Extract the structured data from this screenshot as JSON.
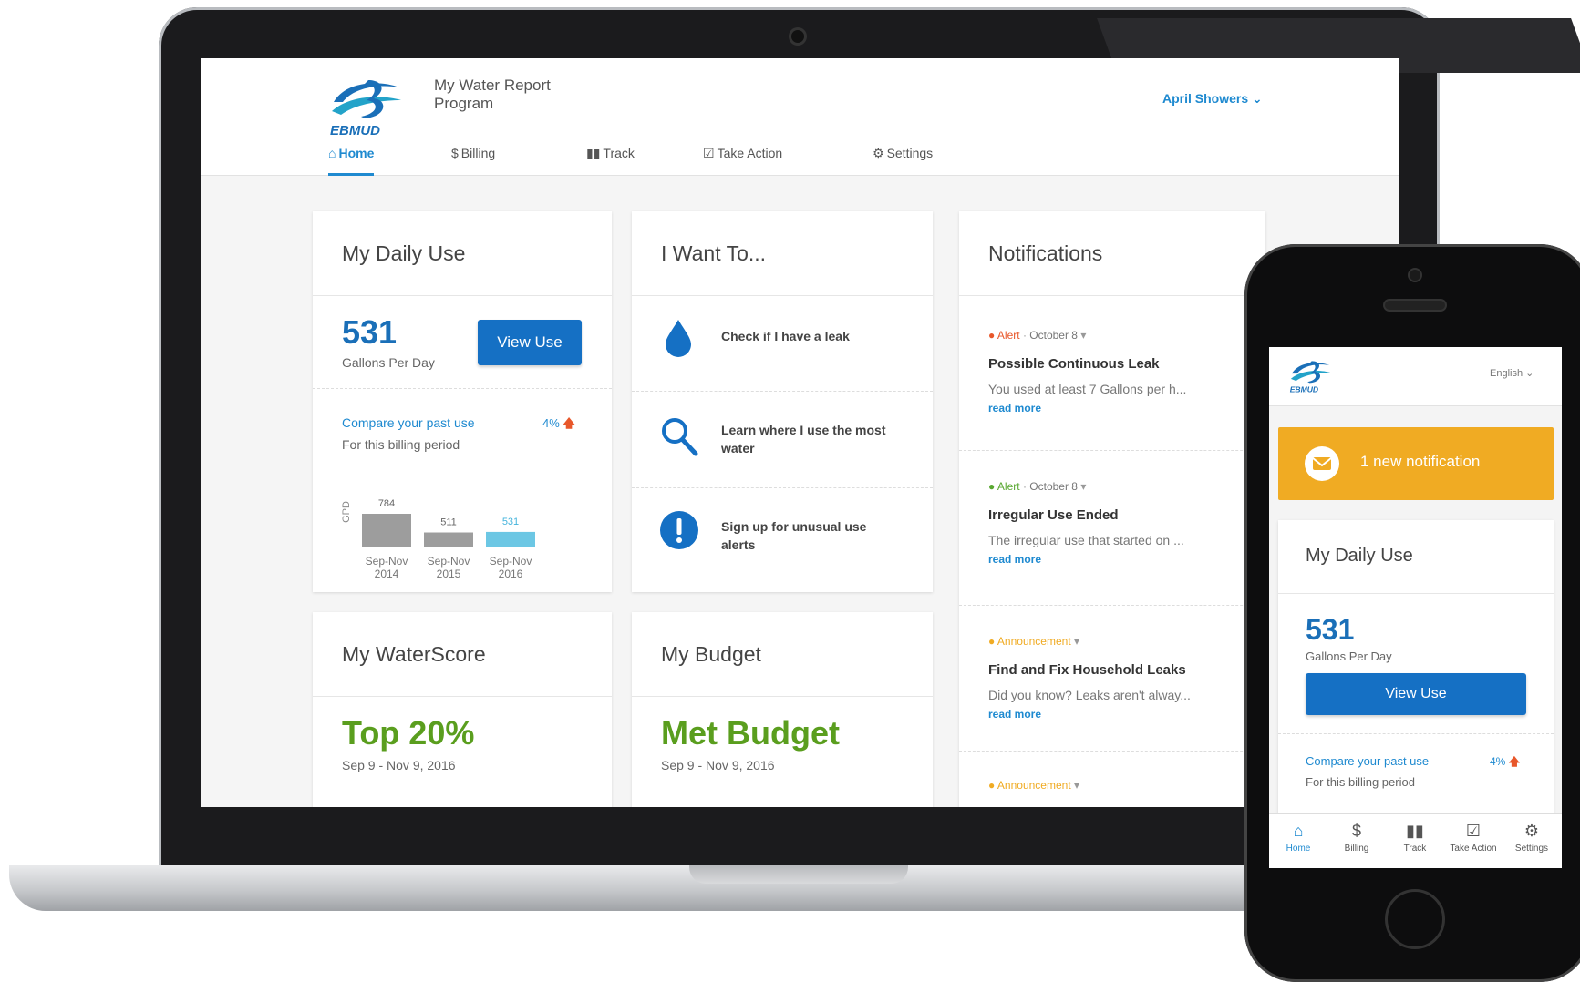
{
  "web": {
    "brand": "EBMUD",
    "program_title": "My Water Report Program",
    "user_name": "April Showers",
    "nav": [
      {
        "label": "Home",
        "icon": "home-icon"
      },
      {
        "label": "Billing",
        "icon": "dollar-icon"
      },
      {
        "label": "Track",
        "icon": "bar-chart-icon"
      },
      {
        "label": "Take Action",
        "icon": "checkbox-icon"
      },
      {
        "label": "Settings",
        "icon": "gear-icon"
      }
    ],
    "daily_use": {
      "title": "My Daily Use",
      "value": "531",
      "unit": "Gallons Per Day",
      "button": "View Use",
      "compare_link": "Compare your past use",
      "compare_pct": "4%",
      "period": "For this billing period"
    },
    "want_to": {
      "title": "I Want To...",
      "items": [
        {
          "label": "Check if I have a leak",
          "icon": "water-drop-icon"
        },
        {
          "label": "Learn where I use the most water",
          "icon": "magnifier-icon"
        },
        {
          "label": "Sign up for unusual use alerts",
          "icon": "exclamation-icon"
        }
      ]
    },
    "notifications": {
      "title": "Notifications",
      "items": [
        {
          "type": "Alert",
          "date": "October 8",
          "title": "Possible Continuous Leak",
          "body": "You used at least 7 Gallons per h...",
          "more": "read more",
          "color": "#e8572a"
        },
        {
          "type": "Alert",
          "date": "October 8",
          "title": "Irregular Use Ended",
          "body": "The irregular use that started on ...",
          "more": "read more",
          "color": "#5aa832"
        },
        {
          "type": "Announcement",
          "date": "",
          "title": "Find and Fix Household Leaks",
          "body": "Did you know? Leaks aren't alway...",
          "more": "read more",
          "color": "#f0ab23"
        },
        {
          "type": "Announcement",
          "date": "",
          "title": "",
          "body": "",
          "more": "",
          "color": "#f0ab23"
        }
      ]
    },
    "waterscore": {
      "title": "My WaterScore",
      "value": "Top 20%",
      "period": "Sep 9 - Nov 9, 2016"
    },
    "budget": {
      "title": "My Budget",
      "value": "Met Budget",
      "period": "Sep 9 - Nov 9, 2016"
    }
  },
  "chart_data": {
    "type": "bar",
    "ylabel": "GPD",
    "categories": [
      "Sep-Nov 2014",
      "Sep-Nov 2015",
      "Sep-Nov 2016"
    ],
    "category_lines": [
      [
        "Sep-Nov",
        "2014"
      ],
      [
        "Sep-Nov",
        "2015"
      ],
      [
        "Sep-Nov",
        "2016"
      ]
    ],
    "values": [
      784,
      511,
      531
    ],
    "value_labels": [
      "784",
      "511",
      "531"
    ],
    "colors": [
      "#9d9d9d",
      "#9d9d9d",
      "#6cc7e4"
    ],
    "label_colors": [
      "#666666",
      "#666666",
      "#45b4dc"
    ],
    "ylim": [
      0,
      784
    ]
  },
  "phone": {
    "brand": "EBMUD",
    "language": "English",
    "banner": "1 new notification",
    "daily_use_title": "My Daily Use",
    "value": "531",
    "unit": "Gallons Per Day",
    "button": "View Use",
    "compare_link": "Compare your past use",
    "compare_pct": "4%",
    "period": "For this billing period",
    "tabs": [
      {
        "label": "Home",
        "icon": "home-icon"
      },
      {
        "label": "Billing",
        "icon": "dollar-icon"
      },
      {
        "label": "Track",
        "icon": "bar-chart-icon"
      },
      {
        "label": "Take Action",
        "icon": "checkbox-icon"
      },
      {
        "label": "Settings",
        "icon": "gear-icon"
      }
    ]
  },
  "colors": {
    "accent": "#1f8ad0",
    "button": "#1570c4",
    "green": "#5a9e1e",
    "notice": "#f0ab23",
    "up_arrow": "#e8572a"
  }
}
